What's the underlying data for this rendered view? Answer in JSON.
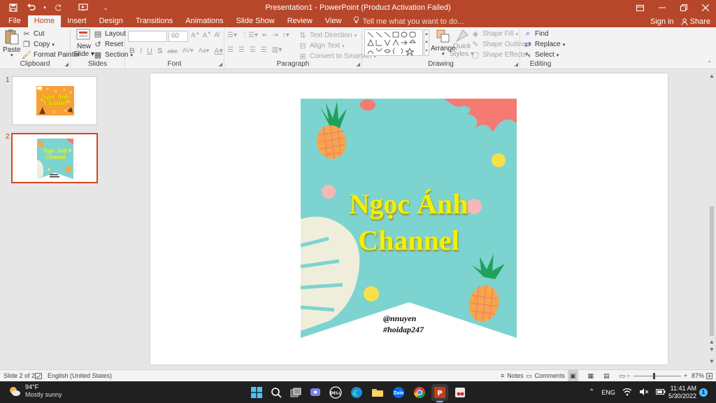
{
  "window": {
    "title": "Presentation1 - PowerPoint (Product Activation Failed)",
    "qat": [
      "save-icon",
      "undo-icon",
      "redo-icon",
      "start-from-beginning-icon",
      "customize-icon"
    ]
  },
  "tabs": [
    "File",
    "Home",
    "Insert",
    "Design",
    "Transitions",
    "Animations",
    "Slide Show",
    "Review",
    "View"
  ],
  "active_tab": "Home",
  "tell_me": "Tell me what you want to do...",
  "sign_in": "Sign in",
  "share": "Share",
  "ribbon": {
    "clipboard": {
      "label": "Clipboard",
      "paste": "Paste",
      "cut": "Cut",
      "copy": "Copy",
      "format_painter": "Format Painter"
    },
    "slides": {
      "label": "Slides",
      "new_slide_1": "New",
      "new_slide_2": "Slide",
      "layout": "Layout",
      "reset": "Reset",
      "section": "Section"
    },
    "font": {
      "label": "Font",
      "font_name": "",
      "font_size": "60"
    },
    "paragraph": {
      "label": "Paragraph",
      "text_direction": "Text Direction",
      "align_text": "Align Text",
      "convert": "Convert to SmartArt"
    },
    "drawing": {
      "label": "Drawing",
      "arrange": "Arrange",
      "quick_styles_1": "Quick",
      "quick_styles_2": "Styles",
      "shape_fill": "Shape Fill",
      "shape_outline": "Shape Outline",
      "shape_effects": "Shape Effects"
    },
    "editing": {
      "label": "Editing",
      "find": "Find",
      "replace": "Replace",
      "select": "Select"
    }
  },
  "thumbnails": [
    {
      "number": "1",
      "title_line1": "Ngọc Ánh",
      "title_line2": "Channel",
      "selected": false
    },
    {
      "number": "2",
      "title_line1": "Ngọc Ánh",
      "title_line2": "Channel",
      "selected": true
    }
  ],
  "slide": {
    "title_line1": "Ngọc Ánh",
    "title_line2": "Channel",
    "handle": "@nnuyen",
    "hashtag": "#hoidap247",
    "colors": {
      "banner": "#7dd3cf",
      "title": "#f4f003",
      "pineapple": "#f6a74a",
      "leaf": "#21a05a",
      "coral": "#f47a72",
      "dot_yellow": "#f8e049",
      "dot_pink": "#f6b8b6",
      "monstera": "#efeedb"
    }
  },
  "status": {
    "slide_of": "Slide 2 of 2",
    "language": "English (United States)",
    "notes": "Notes",
    "comments": "Comments",
    "zoom": "87%"
  },
  "taskbar": {
    "weather_temp": "94°F",
    "weather_desc": "Mostly sunny",
    "lang": "ENG",
    "time": "11:41 AM",
    "date": "5/30/2022",
    "notification_count": "1"
  }
}
